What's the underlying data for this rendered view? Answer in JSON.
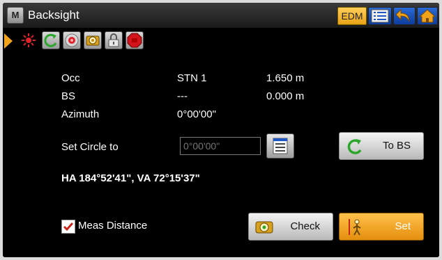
{
  "titlebar": {
    "menu_letter": "M",
    "title": "Backsight",
    "edm_label": "EDM"
  },
  "statusbar": {
    "icons": [
      "arrow-icon",
      "laser-icon",
      "rotate-icon",
      "target-icon",
      "prism-icon",
      "lock-icon",
      "stop-icon"
    ]
  },
  "info": {
    "occ_label": "Occ",
    "occ_value": "STN 1",
    "occ_height": "1.650 m",
    "bs_label": "BS",
    "bs_value": "---",
    "bs_height": "0.000 m",
    "azimuth_label": "Azimuth",
    "azimuth_value": "0°00'00\""
  },
  "circle": {
    "label": "Set Circle to",
    "placeholder": "0°00'00\""
  },
  "angles": "HA 184°52'41\", VA 72°15'37\"",
  "buttons": {
    "to_bs": "To BS",
    "check": "Check",
    "set": "Set"
  },
  "meas_distance": {
    "label": "Meas Distance",
    "checked": true
  },
  "colors": {
    "accent": "#f0a21a",
    "blue": "#1f58c4"
  }
}
